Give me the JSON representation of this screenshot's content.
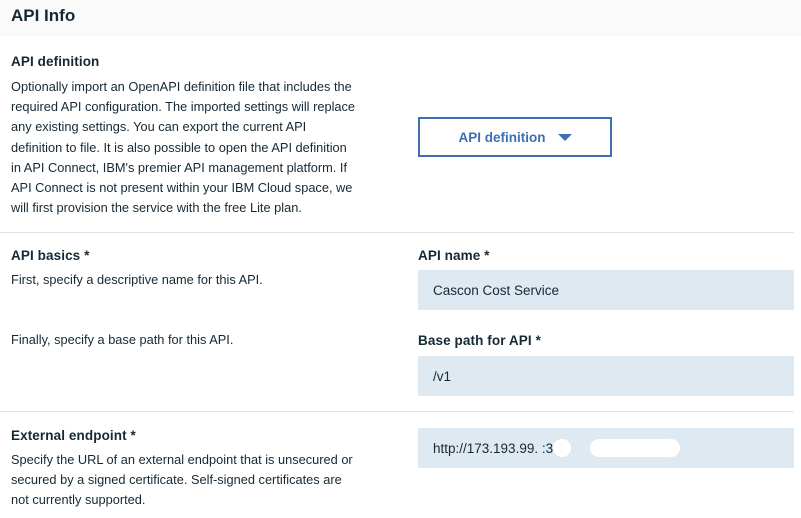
{
  "page": {
    "title": "API Info"
  },
  "definition": {
    "heading": "API definition",
    "lines": [
      "Optionally import an OpenAPI definition file that includes the",
      "required API configuration. The imported settings will replace",
      "any existing settings. You can export the current API",
      "definition to file. It is also possible to open the API definition",
      "in API Connect, IBM's premier API management platform. If",
      "API Connect is not present within your IBM Cloud space, we",
      "will first provision the service with the free Lite plan."
    ],
    "button_label": "API definition",
    "button_icon": "caret-down-icon"
  },
  "basics": {
    "heading": "API basics *",
    "name_hint": "First, specify a descriptive name for this API.",
    "path_hint": "Finally, specify a base path for this API.",
    "name_label": "API name *",
    "name_value": "Cascon Cost Service",
    "path_label": "Base path for API *",
    "path_value": "/v1"
  },
  "endpoint": {
    "heading": "External endpoint *",
    "lines": [
      "Specify the URL of an external endpoint that is unsecured or",
      "secured by a signed certificate. Self-signed certificates are",
      "not currently supported."
    ],
    "value": "http://173.193.99.   :3"
  },
  "colors": {
    "accent": "#3d70b2",
    "field_bg": "#dfe9f2",
    "text": "#152935",
    "divider": "#dfe3e6"
  }
}
